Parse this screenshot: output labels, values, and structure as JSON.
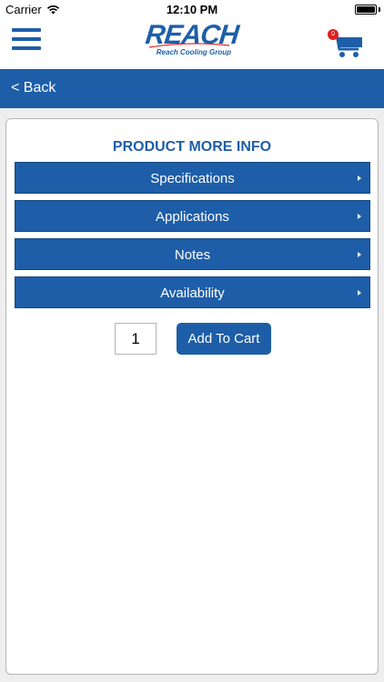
{
  "status_bar": {
    "carrier": "Carrier",
    "time": "12:10 PM",
    "icons": [
      "wifi-icon",
      "battery-icon"
    ]
  },
  "header": {
    "logo_text": "REACH",
    "logo_subtitle": "Reach Cooling Group",
    "cart_count": "0",
    "icons": [
      "menu-icon",
      "cart-icon"
    ]
  },
  "nav": {
    "back_label": "< Back"
  },
  "main": {
    "title": "PRODUCT MORE INFO",
    "sections": [
      {
        "label": "Specifications"
      },
      {
        "label": "Applications"
      },
      {
        "label": "Notes"
      },
      {
        "label": "Availability"
      }
    ],
    "quantity": "1",
    "add_to_cart_label": "Add To Cart"
  },
  "colors": {
    "brand_blue": "#1e5ea8",
    "badge_red": "#e02020",
    "background_gray": "#eeeeee"
  }
}
